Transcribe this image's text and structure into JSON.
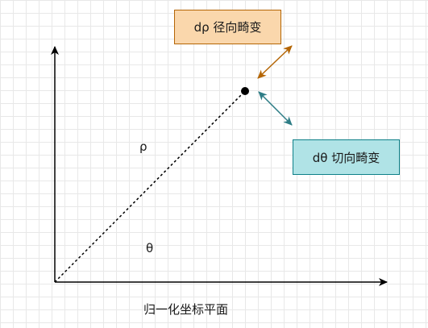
{
  "diagram": {
    "radial_box": {
      "label": "dρ 径向畸变",
      "fill": "#fad7ac",
      "stroke": "#b46504"
    },
    "tangential_box": {
      "label": "dθ 切向畸变",
      "fill": "#b0e3e6",
      "stroke": "#0e8088"
    },
    "rho_label": "ρ",
    "theta_label": "θ",
    "plane_label": "归一化坐标平面",
    "colors": {
      "axis": "#000000",
      "radial_arrow": "#b46504",
      "tangential_arrow": "#2e7d86",
      "grid": "#e8e8e8"
    }
  }
}
